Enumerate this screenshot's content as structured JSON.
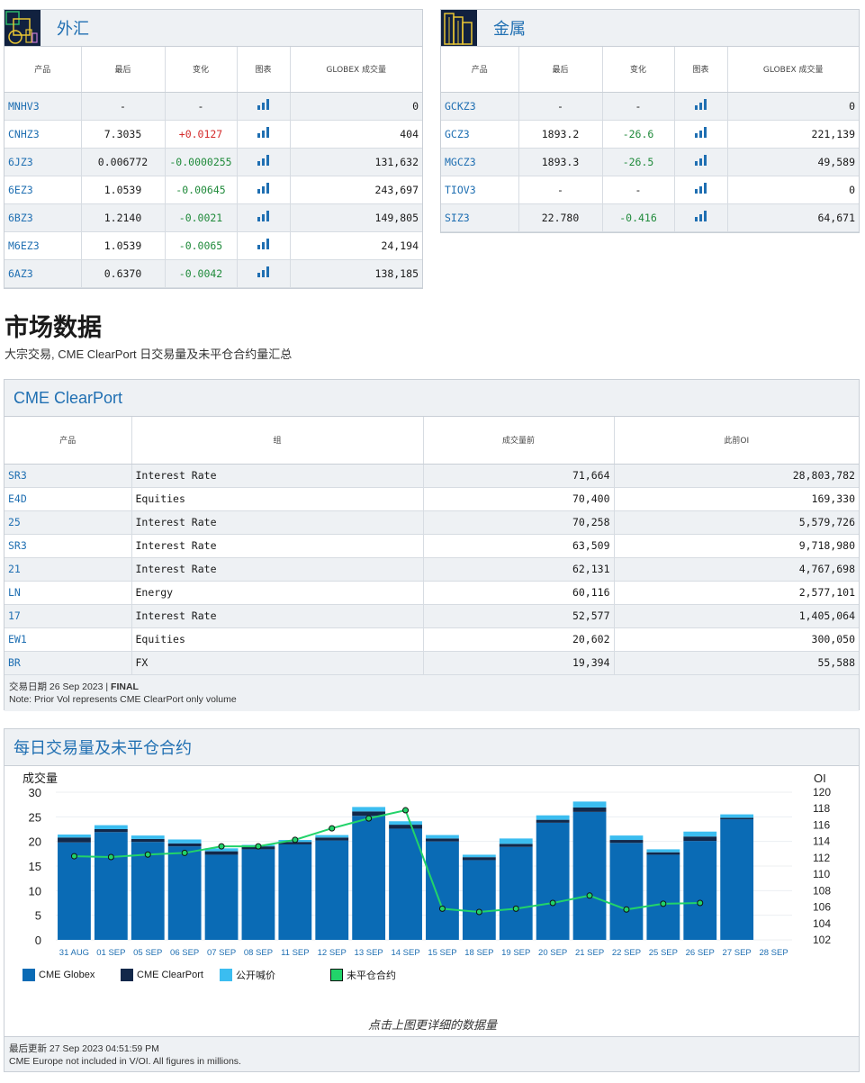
{
  "fx": {
    "title": "外汇",
    "headers": [
      "产品",
      "最后",
      "变化",
      "图表",
      "GLOBEX 成交量"
    ],
    "rows": [
      {
        "code": "MNHV3",
        "last": "-",
        "change": "-",
        "volume": "0",
        "dir": "none"
      },
      {
        "code": "CNHZ3",
        "last": "7.3035",
        "change": "+0.0127",
        "volume": "404",
        "dir": "pos"
      },
      {
        "code": "6JZ3",
        "last": "0.006772",
        "change": "-0.0000255",
        "volume": "131,632",
        "dir": "neg"
      },
      {
        "code": "6EZ3",
        "last": "1.0539",
        "change": "-0.00645",
        "volume": "243,697",
        "dir": "neg"
      },
      {
        "code": "6BZ3",
        "last": "1.2140",
        "change": "-0.0021",
        "volume": "149,805",
        "dir": "neg"
      },
      {
        "code": "M6EZ3",
        "last": "1.0539",
        "change": "-0.0065",
        "volume": "24,194",
        "dir": "neg"
      },
      {
        "code": "6AZ3",
        "last": "0.6370",
        "change": "-0.0042",
        "volume": "138,185",
        "dir": "neg"
      }
    ]
  },
  "metals": {
    "title": "金属",
    "headers": [
      "产品",
      "最后",
      "变化",
      "图表",
      "GLOBEX 成交量"
    ],
    "rows": [
      {
        "code": "GCKZ3",
        "last": "-",
        "change": "-",
        "volume": "0",
        "dir": "none"
      },
      {
        "code": "GCZ3",
        "last": "1893.2",
        "change": "-26.6",
        "volume": "221,139",
        "dir": "neg"
      },
      {
        "code": "MGCZ3",
        "last": "1893.3",
        "change": "-26.5",
        "volume": "49,589",
        "dir": "neg"
      },
      {
        "code": "TIOV3",
        "last": "-",
        "change": "-",
        "volume": "0",
        "dir": "none"
      },
      {
        "code": "SIZ3",
        "last": "22.780",
        "change": "-0.416",
        "volume": "64,671",
        "dir": "neg"
      }
    ]
  },
  "market": {
    "title": "市场数据",
    "subtitle": "大宗交易, CME ClearPort 日交易量及未平仓合约量汇总"
  },
  "clearport": {
    "title": "CME ClearPort",
    "headers": [
      "产品",
      "组",
      "成交量前",
      "此前OI"
    ],
    "rows": [
      {
        "code": "SR3",
        "group": "Interest Rate",
        "vol": "71,664",
        "oi": "28,803,782"
      },
      {
        "code": "E4D",
        "group": "Equities",
        "vol": "70,400",
        "oi": "169,330"
      },
      {
        "code": "25",
        "group": "Interest Rate",
        "vol": "70,258",
        "oi": "5,579,726"
      },
      {
        "code": "SR3",
        "group": "Interest Rate",
        "vol": "63,509",
        "oi": "9,718,980"
      },
      {
        "code": "21",
        "group": "Interest Rate",
        "vol": "62,131",
        "oi": "4,767,698"
      },
      {
        "code": "LN",
        "group": "Energy",
        "vol": "60,116",
        "oi": "2,577,101"
      },
      {
        "code": "17",
        "group": "Interest Rate",
        "vol": "52,577",
        "oi": "1,405,064"
      },
      {
        "code": "EW1",
        "group": "Equities",
        "vol": "20,602",
        "oi": "300,050"
      },
      {
        "code": "BR",
        "group": "FX",
        "vol": "19,394",
        "oi": "55,588"
      }
    ],
    "trade_date_label": "交易日期 26 Sep 2023 | ",
    "trade_date_status": "FINAL",
    "note": "Note: Prior Vol represents CME ClearPort only volume"
  },
  "daily": {
    "title": "每日交易量及未平仓合约",
    "click_note": "点击上图更详细的数据量",
    "last_updated": "最后更新 27 Sep 2023 04:51:59 PM",
    "footer_note": "CME Europe not included in V/OI. All figures in millions."
  },
  "colors": {
    "globex": "#0a6bb5",
    "clearport": "#12284a",
    "open_outcry": "#3bbdf0",
    "oi_line": "#22d36a",
    "accent": "#1f6fb2"
  },
  "chart_data": {
    "type": "bar",
    "ylabel": "成交量",
    "y2label": "OI",
    "ylim": [
      0,
      30
    ],
    "y2lim": [
      102,
      120
    ],
    "yticks": [
      0,
      5,
      10,
      15,
      20,
      25,
      30
    ],
    "y2ticks": [
      102,
      104,
      106,
      108,
      110,
      112,
      114,
      116,
      118,
      120
    ],
    "categories": [
      "31 AUG",
      "01 SEP",
      "05 SEP",
      "06 SEP",
      "07 SEP",
      "08 SEP",
      "11 SEP",
      "12 SEP",
      "13 SEP",
      "14 SEP",
      "15 SEP",
      "18 SEP",
      "19 SEP",
      "20 SEP",
      "21 SEP",
      "22 SEP",
      "25 SEP",
      "26 SEP",
      "27 SEP",
      "28 SEP"
    ],
    "series": [
      {
        "name": "CME Globex",
        "values": [
          19.8,
          21.9,
          19.9,
          19.0,
          17.3,
          18.4,
          19.4,
          20.2,
          25.2,
          22.6,
          20.0,
          16.2,
          18.9,
          23.8,
          26.0,
          19.7,
          17.3,
          20.1,
          24.5,
          null
        ]
      },
      {
        "name": "CME ClearPort",
        "values": [
          1.0,
          0.6,
          0.6,
          0.6,
          0.7,
          0.6,
          0.5,
          0.6,
          0.9,
          0.8,
          0.6,
          0.6,
          0.6,
          0.6,
          0.9,
          0.6,
          0.5,
          0.9,
          0.3,
          null
        ]
      },
      {
        "name": "公开喊价",
        "values": [
          0.6,
          0.8,
          0.7,
          0.8,
          0.6,
          0.3,
          0.4,
          0.5,
          0.9,
          0.7,
          0.7,
          0.5,
          1.1,
          0.9,
          1.2,
          0.9,
          0.6,
          1.0,
          0.7,
          null
        ]
      },
      {
        "name": "未平仓合约",
        "axis": "y2",
        "values": [
          112.2,
          112.1,
          112.4,
          112.6,
          113.4,
          113.4,
          114.2,
          115.6,
          116.8,
          117.8,
          105.8,
          105.4,
          105.8,
          106.5,
          107.4,
          105.7,
          106.4,
          106.5,
          null,
          null
        ]
      }
    ],
    "legend_position": "bottom-left"
  }
}
